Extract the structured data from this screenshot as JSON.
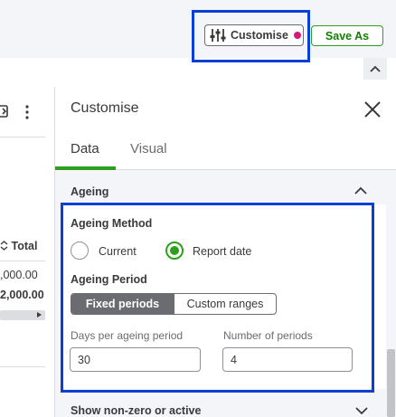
{
  "toolbar": {
    "customise_label": "Customise",
    "save_as_label": "Save As",
    "accent_green": "#2ca01c",
    "notification_color": "#d11a7a",
    "highlight_color": "#0a3fd6"
  },
  "report": {
    "total_header": "Total",
    "value_row_1": ",000.00",
    "value_row_2": "2,000.00"
  },
  "panel": {
    "title": "Customise",
    "tabs": [
      {
        "label": "Data",
        "active": true
      },
      {
        "label": "Visual",
        "active": false
      }
    ],
    "sections": {
      "ageing": {
        "title": "Ageing",
        "expanded": true,
        "method_label": "Ageing Method",
        "method_options": [
          {
            "label": "Current",
            "selected": false
          },
          {
            "label": "Report date",
            "selected": true
          }
        ],
        "period_label": "Ageing Period",
        "period_options": [
          {
            "label": "Fixed periods",
            "selected": true
          },
          {
            "label": "Custom ranges",
            "selected": false
          }
        ],
        "days_label": "Days per ageing period",
        "days_value": "30",
        "periods_label": "Number of periods",
        "periods_value": "4"
      },
      "non_zero": {
        "title": "Show non-zero or active",
        "expanded": false
      }
    }
  }
}
